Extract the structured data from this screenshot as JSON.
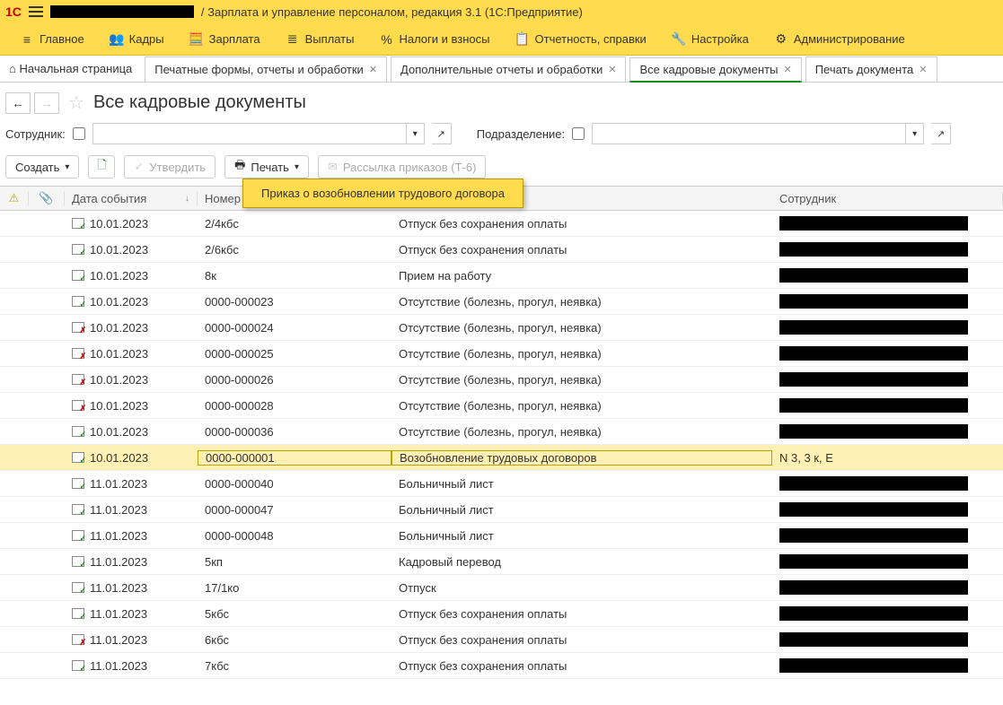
{
  "titlebar": {
    "app_title": "/ Зарплата и управление персоналом, редакция 3.1  (1С:Предприятие)"
  },
  "mainmenu": {
    "items": [
      {
        "label": "Главное",
        "icon": "≡"
      },
      {
        "label": "Кадры",
        "icon": "👥"
      },
      {
        "label": "Зарплата",
        "icon": "🧮"
      },
      {
        "label": "Выплаты",
        "icon": "≣"
      },
      {
        "label": "Налоги и взносы",
        "icon": "%"
      },
      {
        "label": "Отчетность, справки",
        "icon": "📋"
      },
      {
        "label": "Настройка",
        "icon": "🔧"
      },
      {
        "label": "Администрирование",
        "icon": "⚙"
      }
    ]
  },
  "tabs": {
    "home": "Начальная страница",
    "items": [
      {
        "label": "Печатные формы, отчеты и обработки",
        "active": false
      },
      {
        "label": "Дополнительные отчеты и обработки",
        "active": false
      },
      {
        "label": "Все кадровые документы",
        "active": true
      },
      {
        "label": "Печать документа",
        "active": false
      }
    ]
  },
  "page": {
    "title": "Все кадровые документы"
  },
  "filters": {
    "employee_label": "Сотрудник:",
    "employee_value": "",
    "department_label": "Подразделение:",
    "department_value": ""
  },
  "toolbar": {
    "create_label": "Создать",
    "approve_label": "Утвердить",
    "print_label": "Печать",
    "mailing_label": "Рассылка приказов (Т-6)",
    "print_menu_item": "Приказ о возобновлении трудового договора"
  },
  "table": {
    "headers": {
      "date": "Дата события",
      "number": "Номер",
      "type": "",
      "employee": "Сотрудник"
    },
    "rows": [
      {
        "icon": "ok",
        "date": "10.01.2023",
        "number": "2/4кбс",
        "type": "Отпуск без сохранения оплаты",
        "employee": ""
      },
      {
        "icon": "ok",
        "date": "10.01.2023",
        "number": "2/6кбс",
        "type": "Отпуск без сохранения оплаты",
        "employee": ""
      },
      {
        "icon": "ok",
        "date": "10.01.2023",
        "number": "8к",
        "type": "Прием на работу",
        "employee": ""
      },
      {
        "icon": "ok",
        "date": "10.01.2023",
        "number": "0000-000023",
        "type": "Отсутствие (болезнь, прогул, неявка)",
        "employee": ""
      },
      {
        "icon": "bad",
        "date": "10.01.2023",
        "number": "0000-000024",
        "type": "Отсутствие (болезнь, прогул, неявка)",
        "employee": ""
      },
      {
        "icon": "bad",
        "date": "10.01.2023",
        "number": "0000-000025",
        "type": "Отсутствие (болезнь, прогул, неявка)",
        "employee": ""
      },
      {
        "icon": "bad",
        "date": "10.01.2023",
        "number": "0000-000026",
        "type": "Отсутствие (болезнь, прогул, неявка)",
        "employee": ""
      },
      {
        "icon": "bad",
        "date": "10.01.2023",
        "number": "0000-000028",
        "type": "Отсутствие (болезнь, прогул, неявка)",
        "employee": ""
      },
      {
        "icon": "ok",
        "date": "10.01.2023",
        "number": "0000-000036",
        "type": "Отсутствие (болезнь, прогул, неявка)",
        "employee": ""
      },
      {
        "icon": "ok",
        "date": "10.01.2023",
        "number": "0000-000001",
        "type": "Возобновление трудовых договоров",
        "employee": "N           3, 3                   к, Е",
        "selected": true
      },
      {
        "icon": "ok",
        "date": "11.01.2023",
        "number": "0000-000040",
        "type": "Больничный лист",
        "employee": ""
      },
      {
        "icon": "ok",
        "date": "11.01.2023",
        "number": "0000-000047",
        "type": "Больничный лист",
        "employee": ""
      },
      {
        "icon": "ok",
        "date": "11.01.2023",
        "number": "0000-000048",
        "type": "Больничный лист",
        "employee": ""
      },
      {
        "icon": "ok",
        "date": "11.01.2023",
        "number": "5кп",
        "type": "Кадровый перевод",
        "employee": ""
      },
      {
        "icon": "ok",
        "date": "11.01.2023",
        "number": "17/1ко",
        "type": "Отпуск",
        "employee": ""
      },
      {
        "icon": "ok",
        "date": "11.01.2023",
        "number": "5кбс",
        "type": "Отпуск без сохранения оплаты",
        "employee": ""
      },
      {
        "icon": "bad",
        "date": "11.01.2023",
        "number": "6кбс",
        "type": "Отпуск без сохранения оплаты",
        "employee": ""
      },
      {
        "icon": "ok",
        "date": "11.01.2023",
        "number": "7кбс",
        "type": "Отпуск без сохранения оплаты",
        "employee": ""
      }
    ]
  }
}
